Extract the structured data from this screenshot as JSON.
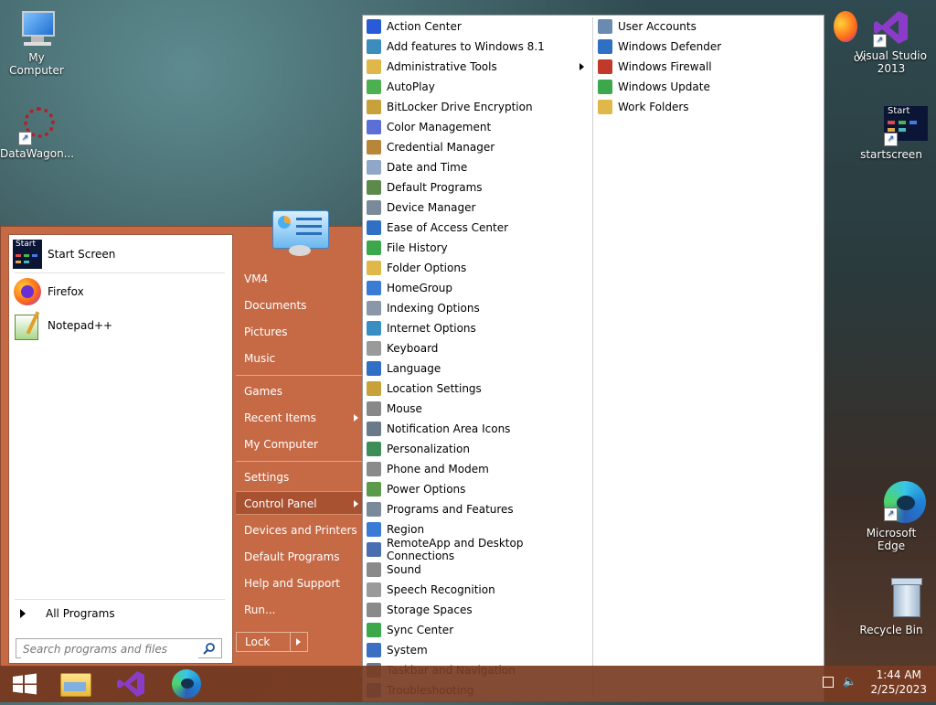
{
  "desktop": {
    "icons": [
      {
        "label": "My Computer"
      },
      {
        "label": "DataWagon..."
      },
      {
        "label": "ox"
      },
      {
        "label": "Visual Studio 2013"
      },
      {
        "label": "startscreen"
      },
      {
        "label": "Microsoft Edge"
      },
      {
        "label": "Recycle Bin"
      }
    ],
    "startscreen_tile_text": "Start"
  },
  "start_menu": {
    "pinned": [
      {
        "label": "Start Screen",
        "icon": "start-screen-icon",
        "tile_text": "Start"
      },
      {
        "label": "Firefox",
        "icon": "firefox-icon"
      },
      {
        "label": "Notepad++",
        "icon": "notepadpp-icon"
      }
    ],
    "all_programs": "All Programs",
    "search_placeholder": "Search programs and files",
    "right_items": [
      {
        "label": "VM4"
      },
      {
        "label": "Documents"
      },
      {
        "label": "Pictures"
      },
      {
        "label": "Music"
      },
      {
        "label": "Games"
      },
      {
        "label": "Recent Items"
      },
      {
        "label": "My Computer"
      },
      {
        "label": "Settings"
      },
      {
        "label": "Control Panel"
      },
      {
        "label": "Devices and Printers"
      },
      {
        "label": "Default Programs"
      },
      {
        "label": "Help and Support"
      },
      {
        "label": "Run..."
      }
    ],
    "lock_label": "Lock"
  },
  "control_panel_menu": {
    "col1": [
      {
        "label": "Action Center",
        "color": "#2a5bd7"
      },
      {
        "label": "Add features to Windows 8.1",
        "color": "#3c8dbc"
      },
      {
        "label": "Administrative Tools",
        "color": "#e0b84a"
      },
      {
        "label": "AutoPlay",
        "color": "#4caf50"
      },
      {
        "label": "BitLocker Drive Encryption",
        "color": "#c9a13a"
      },
      {
        "label": "Color Management",
        "color": "#5b6fd6"
      },
      {
        "label": "Credential Manager",
        "color": "#b8863b"
      },
      {
        "label": "Date and Time",
        "color": "#8fa7c9"
      },
      {
        "label": "Default Programs",
        "color": "#5b8a4c"
      },
      {
        "label": "Device Manager",
        "color": "#7a8a99"
      },
      {
        "label": "Ease of Access Center",
        "color": "#2f6fc4"
      },
      {
        "label": "File History",
        "color": "#3da84b"
      },
      {
        "label": "Folder Options",
        "color": "#e0b84a"
      },
      {
        "label": "HomeGroup",
        "color": "#3a7bd5"
      },
      {
        "label": "Indexing Options",
        "color": "#8a97a8"
      },
      {
        "label": "Internet Options",
        "color": "#3a8fc2"
      },
      {
        "label": "Keyboard",
        "color": "#9a9a9a"
      },
      {
        "label": "Language",
        "color": "#2f6fc4"
      },
      {
        "label": "Location Settings",
        "color": "#c9a13a"
      },
      {
        "label": "Mouse",
        "color": "#888888"
      },
      {
        "label": "Notification Area Icons",
        "color": "#6a7a88"
      },
      {
        "label": "Personalization",
        "color": "#3e8e5a"
      },
      {
        "label": "Phone and Modem",
        "color": "#8a8a8a"
      },
      {
        "label": "Power Options",
        "color": "#5a9a4a"
      },
      {
        "label": "Programs and Features",
        "color": "#7a8a99"
      },
      {
        "label": "Region",
        "color": "#3a7bd5"
      },
      {
        "label": "RemoteApp and Desktop Connections",
        "color": "#4a6fb0"
      },
      {
        "label": "Sound",
        "color": "#8a8a8a"
      },
      {
        "label": "Speech Recognition",
        "color": "#9a9a9a"
      },
      {
        "label": "Storage Spaces",
        "color": "#8a8a8a"
      },
      {
        "label": "Sync Center",
        "color": "#3da84b"
      },
      {
        "label": "System",
        "color": "#3a6fc2"
      },
      {
        "label": "Taskbar and Navigation",
        "color": "#6a7a88"
      },
      {
        "label": "Troubleshooting",
        "color": "#4a7ac2"
      }
    ],
    "col2": [
      {
        "label": "User Accounts",
        "color": "#6a8ab0"
      },
      {
        "label": "Windows Defender",
        "color": "#2f6fc4"
      },
      {
        "label": "Windows Firewall",
        "color": "#c0392b"
      },
      {
        "label": "Windows Update",
        "color": "#3da84b"
      },
      {
        "label": "Work Folders",
        "color": "#e0b84a"
      }
    ]
  },
  "taskbar": {
    "time": "1:44 AM",
    "date": "2/25/2023"
  }
}
